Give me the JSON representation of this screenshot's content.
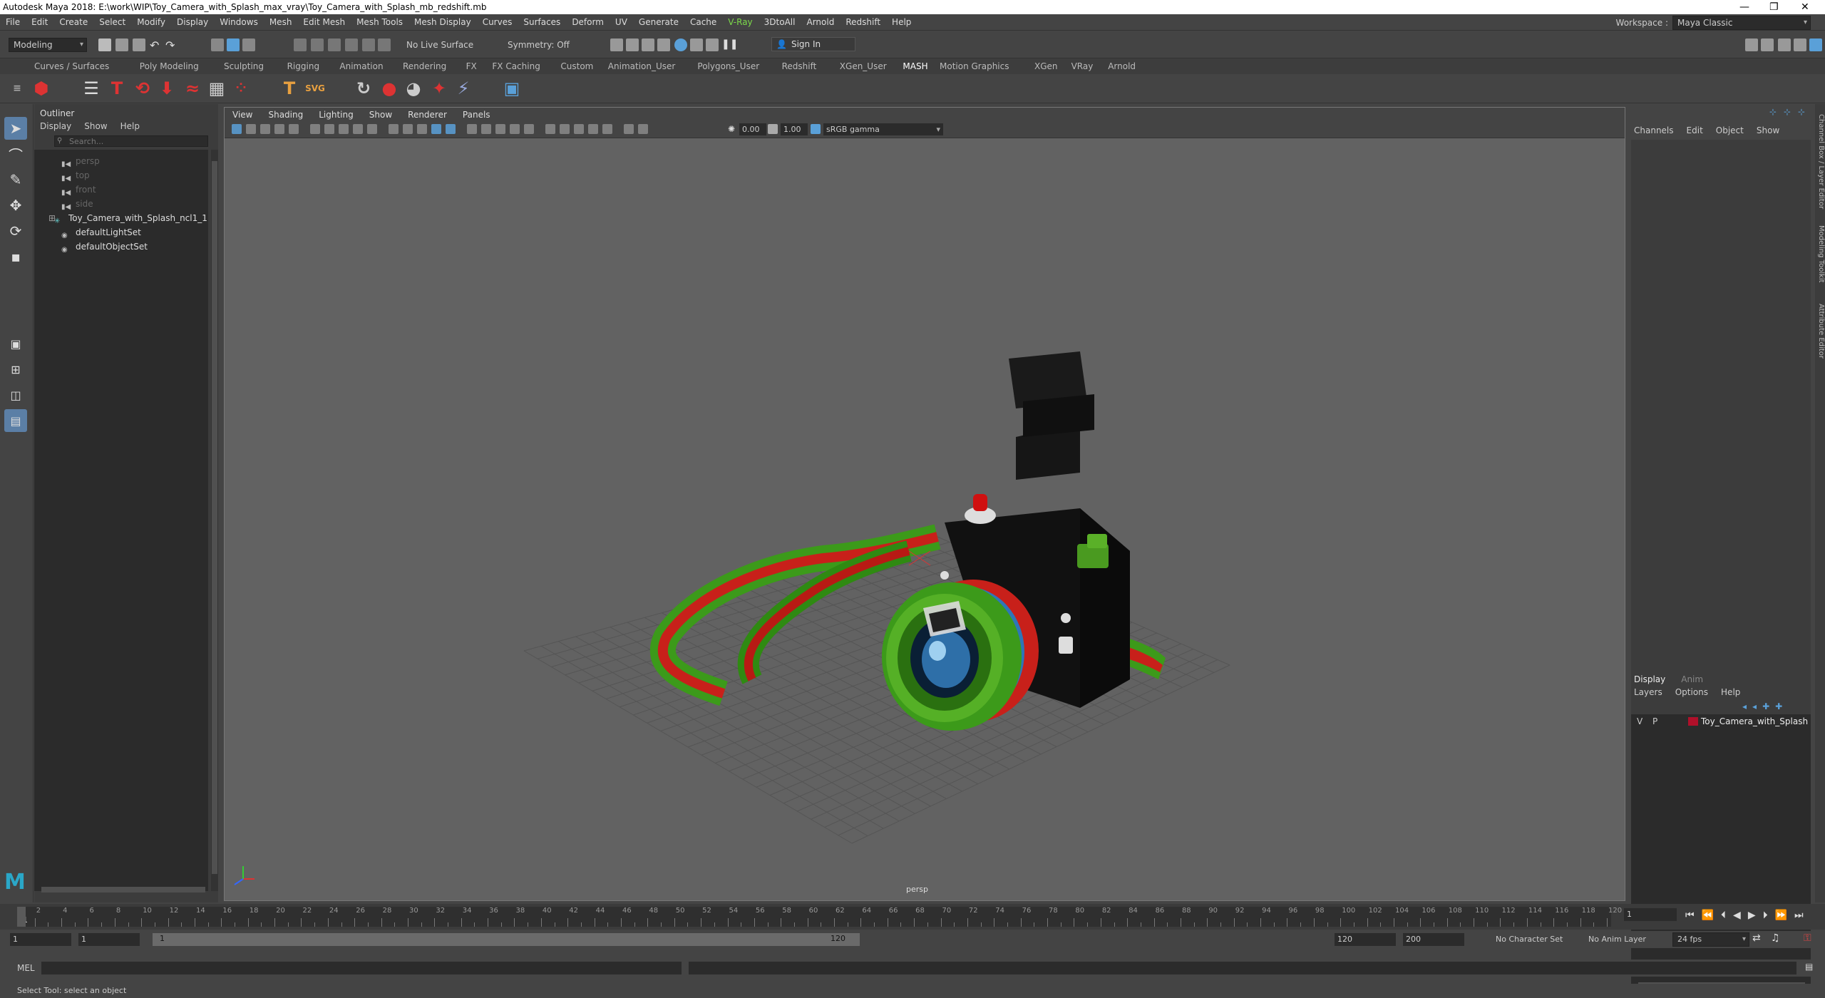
{
  "window": {
    "title": "Autodesk Maya 2018: E:\\work\\WIP\\Toy_Camera_with_Splash_max_vray\\Toy_Camera_with_Splash_mb_redshift.mb"
  },
  "menubar": {
    "items": [
      "File",
      "Edit",
      "Create",
      "Select",
      "Modify",
      "Display",
      "Windows",
      "Mesh",
      "Edit Mesh",
      "Mesh Tools",
      "Mesh Display",
      "Curves",
      "Surfaces",
      "Deform",
      "UV",
      "Generate",
      "Cache",
      "V-Ray",
      "3DtoAll",
      "Arnold",
      "Redshift",
      "Help"
    ],
    "workspace_label": "Workspace :",
    "workspace_value": "Maya Classic"
  },
  "statusline": {
    "mode": "Modeling",
    "live_surface": "No Live Surface",
    "symmetry": "Symmetry: Off",
    "sign_in": "Sign In"
  },
  "shelf": {
    "tabs": [
      "Curves / Surfaces",
      "Poly Modeling",
      "Sculpting",
      "Rigging",
      "Animation",
      "Rendering",
      "FX",
      "FX Caching",
      "Custom",
      "Animation_User",
      "Polygons_User",
      "Redshift",
      "XGen_User",
      "MASH",
      "Motion Graphics",
      "XGen",
      "VRay",
      "Arnold"
    ],
    "active_tab": "MASH"
  },
  "outliner": {
    "title": "Outliner",
    "menu": [
      "Display",
      "Show",
      "Help"
    ],
    "search_placeholder": "Search...",
    "items": [
      {
        "name": "persp",
        "dim": true
      },
      {
        "name": "top",
        "dim": true
      },
      {
        "name": "front",
        "dim": true
      },
      {
        "name": "side",
        "dim": true
      },
      {
        "name": "Toy_Camera_with_Splash_ncl1_1",
        "dim": false
      },
      {
        "name": "defaultLightSet",
        "dim": false
      },
      {
        "name": "defaultObjectSet",
        "dim": false
      }
    ]
  },
  "viewport": {
    "menu": [
      "View",
      "Shading",
      "Lighting",
      "Show",
      "Renderer",
      "Panels"
    ],
    "exposure": "0.00",
    "gamma": "1.00",
    "color_space": "sRGB gamma",
    "camera_label": "persp"
  },
  "channelbox": {
    "menu": [
      "Channels",
      "Edit",
      "Object",
      "Show"
    ],
    "layer_tabs": [
      "Display",
      "Anim"
    ],
    "layer_menu": [
      "Layers",
      "Options",
      "Help"
    ],
    "layer": {
      "v": "V",
      "p": "P",
      "name": "Toy_Camera_with_Splash",
      "color": "#b0102a"
    },
    "side_tabs": [
      "Channel Box / Layer Editor",
      "Modeling Toolkit",
      "Attribute Editor"
    ]
  },
  "timeslider": {
    "ticks": [
      "1",
      "2",
      "4",
      "6",
      "8",
      "10",
      "12",
      "14",
      "16",
      "18",
      "20",
      "22",
      "24",
      "26",
      "28",
      "30",
      "32",
      "34",
      "36",
      "38",
      "40",
      "42",
      "44",
      "46",
      "48",
      "50",
      "52",
      "54",
      "56",
      "58",
      "60",
      "62",
      "64",
      "66",
      "68",
      "70",
      "72",
      "74",
      "76",
      "78",
      "80",
      "82",
      "84",
      "86",
      "88",
      "90",
      "92",
      "94",
      "96",
      "98",
      "100",
      "102",
      "104",
      "106",
      "108",
      "110",
      "112",
      "114",
      "116",
      "118",
      "120"
    ],
    "current_frame": "1"
  },
  "rangeslider": {
    "start": "1",
    "playback_start": "1",
    "range_start": "1",
    "range_end": "120",
    "playback_end": "120",
    "end": "200",
    "character_set": "No Character Set",
    "anim_layer": "No Anim Layer",
    "fps": "24 fps"
  },
  "cmdline": {
    "label": "MEL"
  },
  "helpline": {
    "text": "Select Tool: select an object"
  }
}
